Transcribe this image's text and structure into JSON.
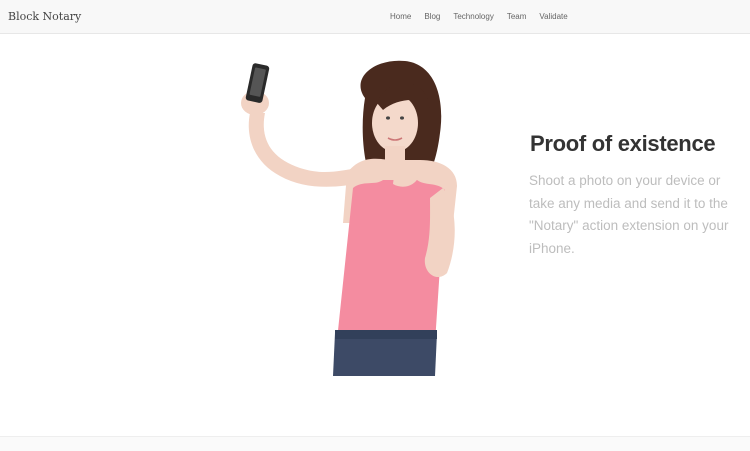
{
  "nav": {
    "brand": "Block Notary",
    "links": [
      "Home",
      "Blog",
      "Technology",
      "Team",
      "Validate"
    ]
  },
  "hero": {
    "heading": "Proof of existence",
    "text": "Shoot a photo on your device or take any media and send it to the \"Notary\" action extension on your iPhone."
  },
  "colors": {
    "navbar_bg": "#f8f8f8",
    "heading": "#333333",
    "body_text": "#bdbdbd",
    "shirt": "#f48ca0",
    "jeans": "#3d4a66",
    "hair": "#4a2a1e"
  }
}
